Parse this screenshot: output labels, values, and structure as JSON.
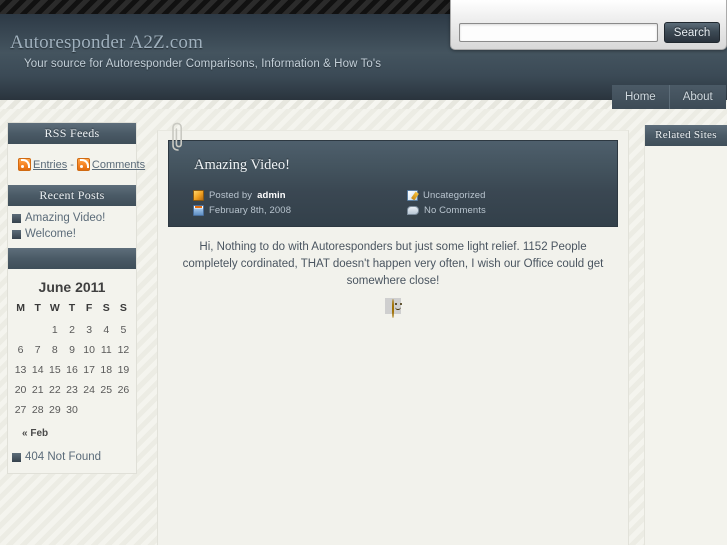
{
  "site": {
    "title": "Autoresponder A2Z.com",
    "tagline": "Your source for Autoresponder Comparisons, Information & How To's"
  },
  "search": {
    "value": "",
    "placeholder": "",
    "button_label": "Search",
    "icon": "search-icon"
  },
  "nav": {
    "tabs": [
      {
        "label": "Home"
      },
      {
        "label": "About"
      }
    ]
  },
  "left_sidebar": {
    "rss_widget": {
      "title": "RSS Feeds",
      "entries_label": "Entries",
      "separator": "-",
      "comments_label": "Comments",
      "icon": "rss-icon"
    },
    "recent_posts_widget": {
      "title": "Recent Posts",
      "items": [
        {
          "label": "Amazing Video!"
        },
        {
          "label": "Welcome!"
        }
      ]
    },
    "calendar_widget": {
      "title": "",
      "caption": "June 2011",
      "weekdays": [
        "M",
        "T",
        "W",
        "T",
        "F",
        "S",
        "S"
      ],
      "weeks": [
        [
          "",
          "",
          "1",
          "2",
          "3",
          "4",
          "5"
        ],
        [
          "6",
          "7",
          "8",
          "9",
          "10",
          "11",
          "12"
        ],
        [
          "13",
          "14",
          "15",
          "16",
          "17",
          "18",
          "19"
        ],
        [
          "20",
          "21",
          "22",
          "23",
          "24",
          "25",
          "26"
        ],
        [
          "27",
          "28",
          "29",
          "30",
          "",
          "",
          ""
        ]
      ],
      "prev_label": "« Feb",
      "not_found_label": "404 Not Found"
    }
  },
  "main": {
    "post": {
      "title": "Amazing Video!",
      "author_prefix": "Posted by ",
      "author": "admin",
      "date": "February 8th, 2008",
      "category": "Uncategorized",
      "comments": "No Comments",
      "body": "Hi, Nothing to do with Autoresponders but just some light relief. 1152 People completely cordinated, THAT doesn't happen very often, I wish our Office could get somewhere close!",
      "emoticon": "smiley-icon"
    }
  },
  "right_sidebar": {
    "widget_title": "Related Sites"
  },
  "colors": {
    "header_dark": "#2d3a46",
    "header_mid": "#44545f",
    "accent_blue": "#4a5a66",
    "page_bg": "#f2f2ec",
    "rss_orange": "#f58020",
    "link_slate": "#5a6a78"
  }
}
